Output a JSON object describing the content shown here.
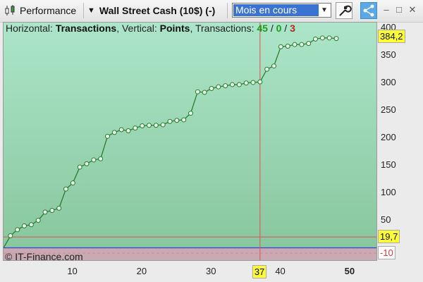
{
  "toolbar": {
    "performance_label": "Performance",
    "instrument_label": "Wall Street Cash (10$) (-)",
    "period_value": "Mois en cours"
  },
  "info": {
    "prefix_h": "Horizontal: ",
    "h_value": "Transactions",
    "prefix_v": ", Vertical: ",
    "v_value": "Points",
    "prefix_t": ", Transactions: ",
    "wins": "45",
    "slash1": " / ",
    "even": "0",
    "slash2": " / ",
    "losses": "3"
  },
  "watermark": "© IT-Finance.com",
  "colors": {
    "line": "#2a7d2a",
    "crosshair": "#e05050",
    "zero_line": "#3344cc",
    "tag_bg": "#ffff33"
  },
  "chart_data": {
    "type": "line",
    "title": "",
    "xlabel": "",
    "ylabel": "",
    "x_ticks": [
      "10",
      "20",
      "30",
      "40",
      "50"
    ],
    "y_ticks": [
      "50",
      "100",
      "150",
      "200",
      "250",
      "300",
      "350",
      "400"
    ],
    "xlim": [
      0,
      54
    ],
    "ylim": [
      -25,
      410
    ],
    "x": [
      1,
      2,
      3,
      4,
      5,
      6,
      7,
      8,
      9,
      10,
      11,
      12,
      13,
      14,
      15,
      16,
      17,
      18,
      19,
      20,
      21,
      22,
      23,
      24,
      25,
      26,
      27,
      28,
      29,
      30,
      31,
      32,
      33,
      34,
      35,
      36,
      37,
      38,
      39,
      40,
      41,
      42,
      43,
      44,
      45,
      46,
      47,
      48
    ],
    "values": [
      22,
      33,
      40,
      42,
      50,
      65,
      68,
      72,
      107,
      118,
      147,
      153,
      160,
      162,
      203,
      210,
      215,
      213,
      218,
      222,
      223,
      223,
      224,
      230,
      232,
      233,
      245,
      284,
      283,
      290,
      293,
      295,
      297,
      297,
      300,
      301,
      302,
      325,
      331,
      366,
      367,
      370,
      370,
      372,
      380,
      382,
      382,
      381
    ],
    "cursor_x": "37",
    "last_value": "384,2",
    "max_dd_value": "19,7",
    "min_value": "-10"
  }
}
